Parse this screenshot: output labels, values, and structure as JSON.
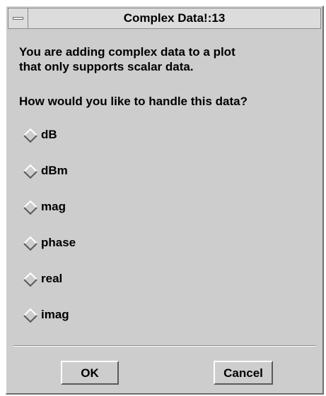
{
  "window": {
    "title": "Complex Data!:13"
  },
  "message": {
    "line1": "You are adding complex data to a plot",
    "line2": "that only supports scalar data.",
    "question": "How would you like to handle this data?"
  },
  "options": [
    {
      "label": "dB",
      "selected": false
    },
    {
      "label": "dBm",
      "selected": false
    },
    {
      "label": "mag",
      "selected": false
    },
    {
      "label": "phase",
      "selected": false
    },
    {
      "label": "real",
      "selected": false
    },
    {
      "label": "imag",
      "selected": false
    }
  ],
  "buttons": {
    "ok": "OK",
    "cancel": "Cancel"
  },
  "icons": {
    "window_menu": "window-menu-icon",
    "radio": "radio-diamond-icon"
  },
  "colors": {
    "dialog_bg": "#cdcdcd",
    "title_bg": "#dcdcdc",
    "bevel_light": "#ffffff",
    "bevel_dark": "#5a5a5a"
  }
}
